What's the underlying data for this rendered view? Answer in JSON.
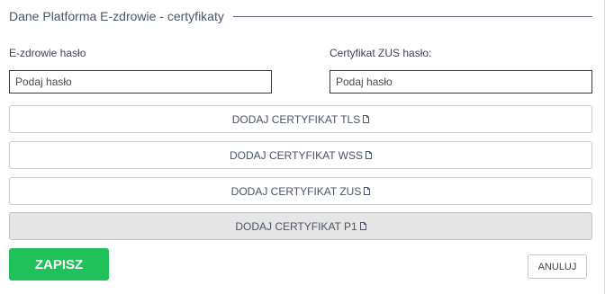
{
  "section": {
    "title": "Dane Platforma E-zdrowie - certyfikaty"
  },
  "fields": {
    "ezdrowie": {
      "label": "E-zdrowie hasło",
      "placeholder": "Podaj hasło",
      "value": ""
    },
    "zus": {
      "label": "Certyfikat ZUS hasło:",
      "placeholder": "Podaj hasło",
      "value": ""
    }
  },
  "cert_buttons": [
    {
      "label": "DODAJ CERTYFIKAT TLS",
      "icon": "document-icon"
    },
    {
      "label": "DODAJ CERTYFIKAT WSS",
      "icon": "document-icon"
    },
    {
      "label": "DODAJ CERTYFIKAT ZUS",
      "icon": "document-icon"
    },
    {
      "label": "DODAJ CERTYFIKAT P1",
      "icon": "document-icon"
    }
  ],
  "actions": {
    "save_label": "ZAPISZ",
    "cancel_label": "ANULUJ"
  },
  "colors": {
    "save_bg": "#20c15a",
    "active_button_bg": "#e6e6e6"
  }
}
